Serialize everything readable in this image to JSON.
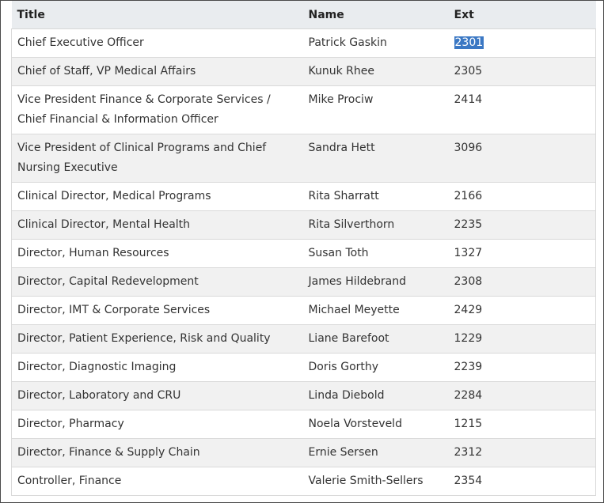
{
  "table": {
    "headers": [
      "Title",
      "Name",
      "Ext"
    ],
    "rows": [
      {
        "title": "Chief Executive Officer",
        "name": "Patrick Gaskin",
        "ext": "2301",
        "ext_selected": true
      },
      {
        "title": "Chief of Staff, VP Medical Affairs",
        "name": "Kunuk Rhee",
        "ext": "2305"
      },
      {
        "title": "Vice President Finance & Corporate Services / Chief Financial & Information Officer",
        "name": "Mike Prociw",
        "ext": "2414"
      },
      {
        "title": "Vice President of Clinical Programs and Chief Nursing Executive",
        "name": "Sandra Hett",
        "ext": "3096"
      },
      {
        "title": "Clinical Director, Medical Programs",
        "name": "Rita Sharratt",
        "ext": "2166"
      },
      {
        "title": "Clinical Director, Mental Health",
        "name": "Rita Silverthorn",
        "ext": "2235"
      },
      {
        "title": "Director, Human Resources",
        "name": "Susan Toth",
        "ext": "1327"
      },
      {
        "title": "Director, Capital Redevelopment",
        "name": "James Hildebrand",
        "ext": "2308"
      },
      {
        "title": "Director, IMT & Corporate Services",
        "name": "Michael Meyette",
        "ext": "2429"
      },
      {
        "title": "Director, Patient Experience, Risk and Quality",
        "name": "Liane Barefoot",
        "ext": "1229"
      },
      {
        "title": "Director, Diagnostic Imaging",
        "name": "Doris Gorthy",
        "ext": "2239"
      },
      {
        "title": "Director, Laboratory and CRU",
        "name": "Linda Diebold",
        "ext": "2284"
      },
      {
        "title": "Director, Pharmacy",
        "name": "Noela Vorsteveld",
        "ext": "1215"
      },
      {
        "title": "Director, Finance & Supply Chain",
        "name": "Ernie Sersen",
        "ext": "2312"
      },
      {
        "title": "Controller, Finance",
        "name": "Valerie Smith-Sellers",
        "ext": "2354"
      }
    ]
  },
  "colors": {
    "header_bg": "#e9ecef",
    "stripe_bg": "#f1f1f1",
    "selection_bg": "#3b78c4"
  }
}
